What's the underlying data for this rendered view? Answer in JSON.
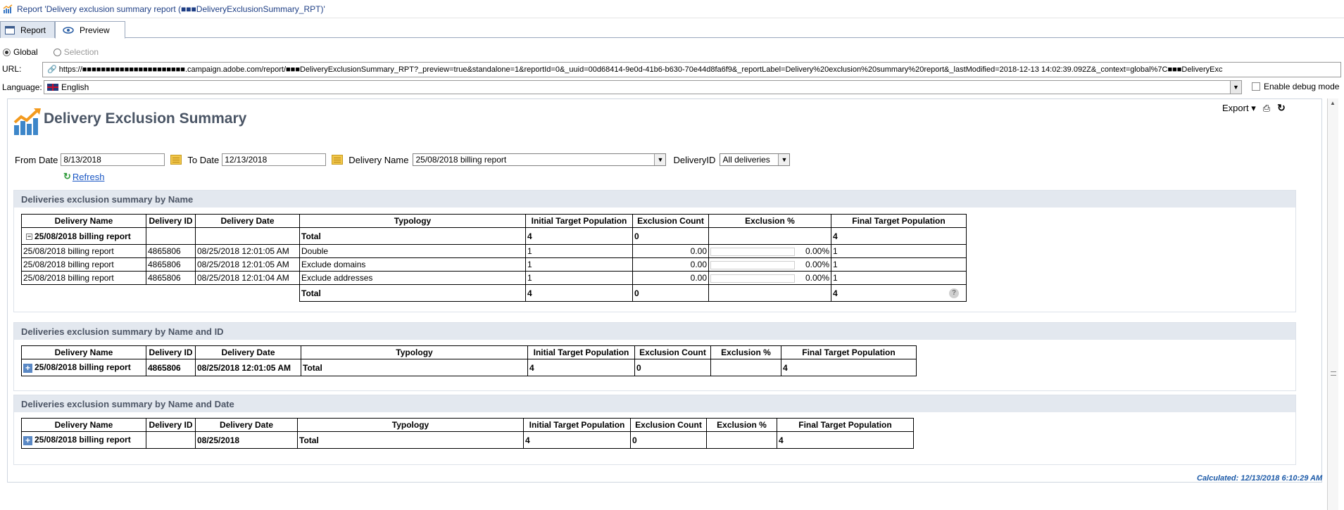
{
  "window": {
    "title": "Report 'Delivery exclusion summary report (■■■DeliveryExclusionSummary_RPT)'"
  },
  "tabs": [
    {
      "label": "Report"
    },
    {
      "label": "Preview"
    }
  ],
  "scope": {
    "global": "Global",
    "selection": "Selection"
  },
  "url_row": {
    "label": "URL:",
    "value": "https://■■■■■■■■■■■■■■■■■■■■■■.campaign.adobe.com/report/■■■DeliveryExclusionSummary_RPT?_preview=true&standalone=1&reportId=0&_uuid=00d68414-9e0d-41b6-b630-70e44d8fa6f9&_reportLabel=Delivery%20exclusion%20summary%20report&_lastModified=2018-12-13 14:02:39.092Z&_context=global%7C■■■DeliveryExc"
  },
  "language_row": {
    "label": "Language:",
    "value": "English",
    "debug_label": "Enable debug mode"
  },
  "report": {
    "title": "Delivery Exclusion Summary",
    "export_label": "Export",
    "calculated": "Calculated: 12/13/2018 6:10:29 AM"
  },
  "filters": {
    "from_label": "From Date",
    "from_value": "8/13/2018",
    "to_label": "To Date",
    "to_value": "12/13/2018",
    "delivery_name_label": "Delivery Name",
    "delivery_name_value": "25/08/2018 billing report",
    "delivery_id_label": "DeliveryID",
    "delivery_id_value": "All deliveries",
    "refresh_label": "Refresh"
  },
  "section1": {
    "title": "Deliveries exclusion summary by Name",
    "headers": [
      "Delivery Name",
      "Delivery ID",
      "Delivery Date",
      "Typology",
      "Initial Target Population",
      "Exclusion Count",
      "Exclusion %",
      "Final Target Population"
    ],
    "group": {
      "name": "25/08/2018 billing report",
      "typology": "Total",
      "initial": "4",
      "exclusion": "0",
      "final": "4"
    },
    "rows": [
      {
        "name": "25/08/2018 billing report",
        "id": "4865806",
        "date": "08/25/2018 12:01:05 AM",
        "typology": "Double",
        "initial": "1",
        "count": "0.00",
        "pct": "0.00%",
        "final": "1"
      },
      {
        "name": "25/08/2018 billing report",
        "id": "4865806",
        "date": "08/25/2018 12:01:05 AM",
        "typology": "Exclude domains",
        "initial": "1",
        "count": "0.00",
        "pct": "0.00%",
        "final": "1"
      },
      {
        "name": "25/08/2018 billing report",
        "id": "4865806",
        "date": "08/25/2018 12:01:04 AM",
        "typology": "Exclude addresses",
        "initial": "1",
        "count": "0.00",
        "pct": "0.00%",
        "final": "1"
      }
    ],
    "total": {
      "typology": "Total",
      "initial": "4",
      "exclusion": "0",
      "final": "4"
    }
  },
  "section2": {
    "title": "Deliveries exclusion summary by Name and ID",
    "headers": [
      "Delivery Name",
      "Delivery ID",
      "Delivery Date",
      "Typology",
      "Initial Target Population",
      "Exclusion Count",
      "Exclusion %",
      "Final Target Population"
    ],
    "row": {
      "name": "25/08/2018 billing report",
      "id": "4865806",
      "date": "08/25/2018 12:01:05 AM",
      "typology": "Total",
      "initial": "4",
      "count": "0",
      "pct": "",
      "final": "4"
    }
  },
  "section3": {
    "title": "Deliveries exclusion summary by Name and Date",
    "headers": [
      "Delivery Name",
      "Delivery ID",
      "Delivery Date",
      "Typology",
      "Initial Target Population",
      "Exclusion Count",
      "Exclusion %",
      "Final Target Population"
    ],
    "row": {
      "name": "25/08/2018 billing report",
      "id": "",
      "date": "08/25/2018",
      "typology": "Total",
      "initial": "4",
      "count": "0",
      "pct": "",
      "final": "4"
    }
  }
}
